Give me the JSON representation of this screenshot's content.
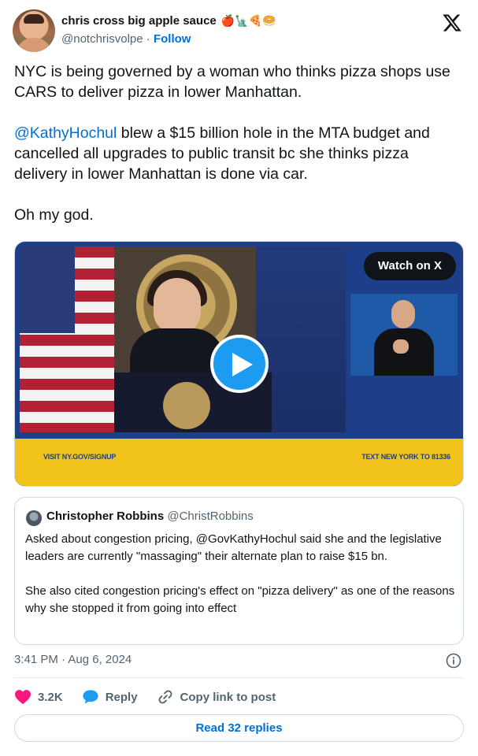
{
  "author": {
    "display_name": "chris cross big apple sauce",
    "name_emojis": "🍎🗽🍕🥯",
    "handle": "@notchrisvolpe",
    "separator": "·",
    "follow_label": "Follow"
  },
  "tweet": {
    "paragraph_1": "NYC is being governed by a woman who thinks pizza shops use CARS to deliver pizza in lower Manhattan.",
    "mention": "@KathyHochul",
    "paragraph_2_rest": " blew a $15 billion hole in the MTA budget and cancelled all upgrades to public transit bc she thinks pizza delivery in lower Manhattan is done via car.",
    "paragraph_3": "Oh my god."
  },
  "media": {
    "watch_label": "Watch on X",
    "banner_left": "VISIT NY.GOV/SIGNUP",
    "banner_right": "TEXT NEW YORK TO 81336",
    "colors": {
      "banner_yellow": "#f2c31b",
      "banner_blue": "#1d3f8a",
      "play_blue": "#1d9bf0"
    }
  },
  "quote": {
    "name": "Christopher Robbins",
    "handle": "@ChristRobbins",
    "paragraph_1": "Asked about congestion pricing, @GovKathyHochul said she and the legislative leaders are currently \"massaging\" their alternate plan to raise $15 bn.",
    "paragraph_2": "She also cited congestion pricing's effect on \"pizza delivery\" as one of the reasons why she stopped it from going into effect"
  },
  "meta": {
    "timestamp": "3:41 PM · Aug 6, 2024"
  },
  "actions": {
    "likes": "3.2K",
    "reply_label": "Reply",
    "copy_label": "Copy link to post",
    "like_color": "#f91880",
    "reply_color": "#1d9bf0"
  },
  "footer": {
    "read_replies": "Read 32 replies"
  },
  "icons": [
    "x-logo-icon",
    "play-icon",
    "info-icon",
    "heart-icon",
    "reply-bubble-icon",
    "link-icon"
  ]
}
